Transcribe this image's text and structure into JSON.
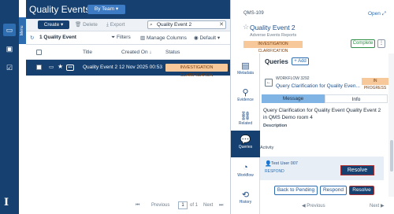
{
  "app": {
    "title": "Quality Events",
    "view_selector": "By Team ▾",
    "menu_tab": "Menu"
  },
  "nav": {
    "icons": [
      "inbox-icon",
      "briefcase-icon",
      "checkbox-icon"
    ]
  },
  "toolbar": {
    "create": "Create ▾",
    "delete": "Delete",
    "export": "Export",
    "search_value": "Quality Event 2"
  },
  "subbar": {
    "count": "1 Quality Event",
    "filters": "Filters",
    "manage_columns": "Manage Columns",
    "default": "Default ▾"
  },
  "table": {
    "headers": [
      "Title",
      "Created On ↓",
      "Status"
    ],
    "rows": [
      {
        "title": "Quality Event 2",
        "created_on": "12 Nov 2025 00:53",
        "status": "INVESTIGATION CLARIFICATION"
      }
    ]
  },
  "pager": {
    "previous": "Previous",
    "page": "1",
    "of": "of 1",
    "next": "Next"
  },
  "record": {
    "id": "QMS-109",
    "open": "Open",
    "title": "Quality Event 2",
    "form": "Adverse Events Reports",
    "status": "INVESTIGATION CLARIFICATION",
    "complete": "Complete"
  },
  "side_tabs": [
    {
      "label": "Metadata",
      "icon": "metadata-icon"
    },
    {
      "label": "Evidence",
      "icon": "evidence-icon"
    },
    {
      "label": "Related",
      "icon": "link-icon"
    },
    {
      "label": "Queries",
      "icon": "queries-icon"
    },
    {
      "label": "Workflow",
      "icon": "workflow-icon"
    },
    {
      "label": "History",
      "icon": "history-icon"
    }
  ],
  "queries": {
    "title": "Queries",
    "add": "Add",
    "workflow_label": "WORKFLOW",
    "workflow_id": "3292",
    "status": "IN PROGRESS",
    "query_title": "Query Clarification for Quality Even...",
    "tabs": [
      "Message",
      "Info"
    ],
    "message": "Query Clarification for Quality Event Quality Event 2 in QMS Demo room 4",
    "description_label": "Description",
    "activity_label": "Activity",
    "activity_user": "Test User 007",
    "activity_action": "RESPOND",
    "resolve_card": "Resolve",
    "back_to_pending": "Back to Pending",
    "respond": "Respond",
    "resolve": "Resolve"
  },
  "colors": {
    "navy": "#16406f",
    "accent": "#2e6db0",
    "badge_orange": "#f6c89a",
    "success": "#2f8f46"
  }
}
